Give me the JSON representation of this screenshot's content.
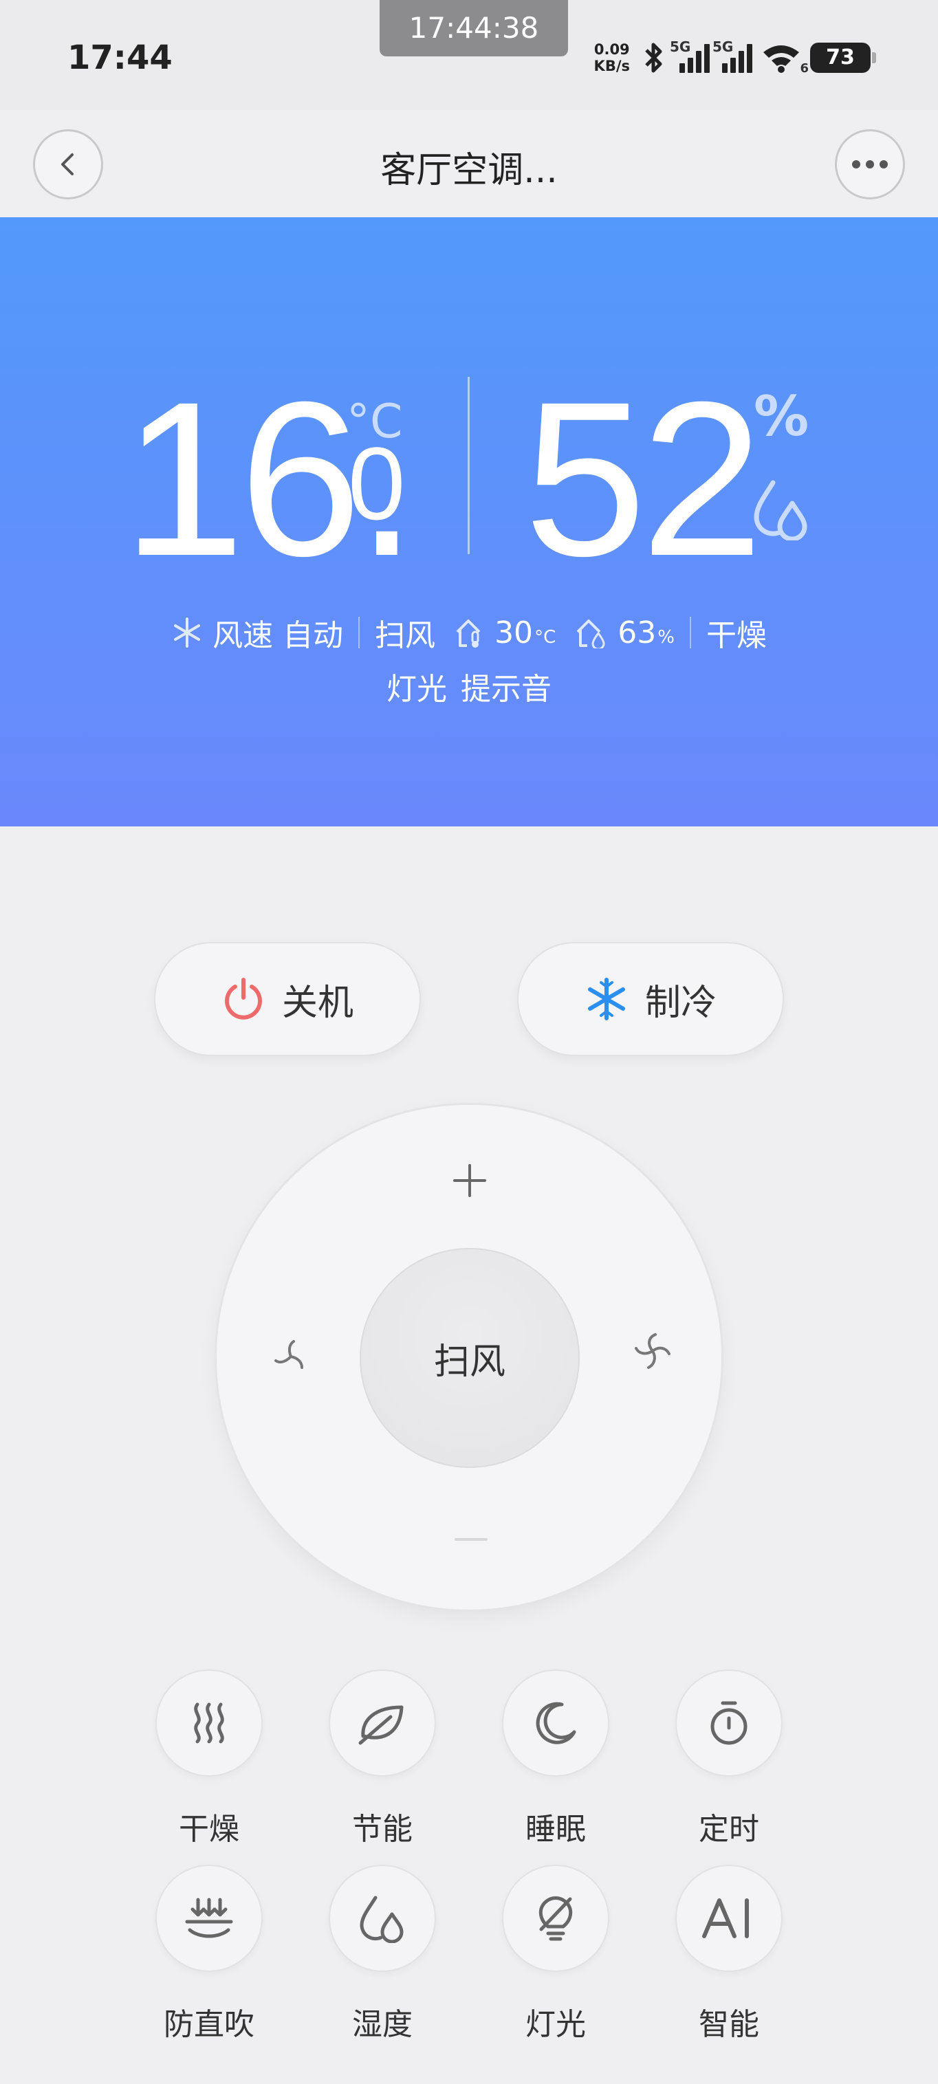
{
  "status_bar": {
    "time": "17:44",
    "screen_timer": "17:44:38",
    "net_speed_value": "0.09",
    "net_speed_unit": "KB/s",
    "sim1_tag": "5G",
    "sim2_tag": "5G",
    "wifi_sub": "6",
    "battery": "73"
  },
  "nav": {
    "title": "客厅空调..."
  },
  "hero": {
    "temperature_int": "16.",
    "temperature_dec": "0",
    "temperature_unit": "°C",
    "humidity": "52",
    "humidity_unit": "%",
    "wind_label": "风速",
    "wind_value": "自动",
    "swing": "扫风",
    "outdoor_temp": "30",
    "outdoor_temp_unit": "°C",
    "indoor_humidity": "63",
    "indoor_humidity_unit": "%",
    "dry": "干燥",
    "light": "灯光",
    "beep": "提示音",
    "colors": {
      "gradient_top": "#5399fb",
      "gradient_bottom": "#6a88fb"
    }
  },
  "controls": {
    "power_label": "关机",
    "mode_label": "制冷",
    "dial_center_label": "扫风",
    "power_color": "#ef6b6b",
    "mode_color": "#2a8ff0"
  },
  "functions": [
    {
      "label": "干燥",
      "icon": "heat-waves-icon"
    },
    {
      "label": "节能",
      "icon": "leaf-icon"
    },
    {
      "label": "睡眠",
      "icon": "moon-icon"
    },
    {
      "label": "定时",
      "icon": "timer-icon"
    },
    {
      "label": "防直吹",
      "icon": "anti-direct-wind-icon"
    },
    {
      "label": "湿度",
      "icon": "humidity-drops-icon"
    },
    {
      "label": "灯光",
      "icon": "light-bulb-off-icon"
    },
    {
      "label": "智能",
      "icon": "ai-icon"
    }
  ]
}
